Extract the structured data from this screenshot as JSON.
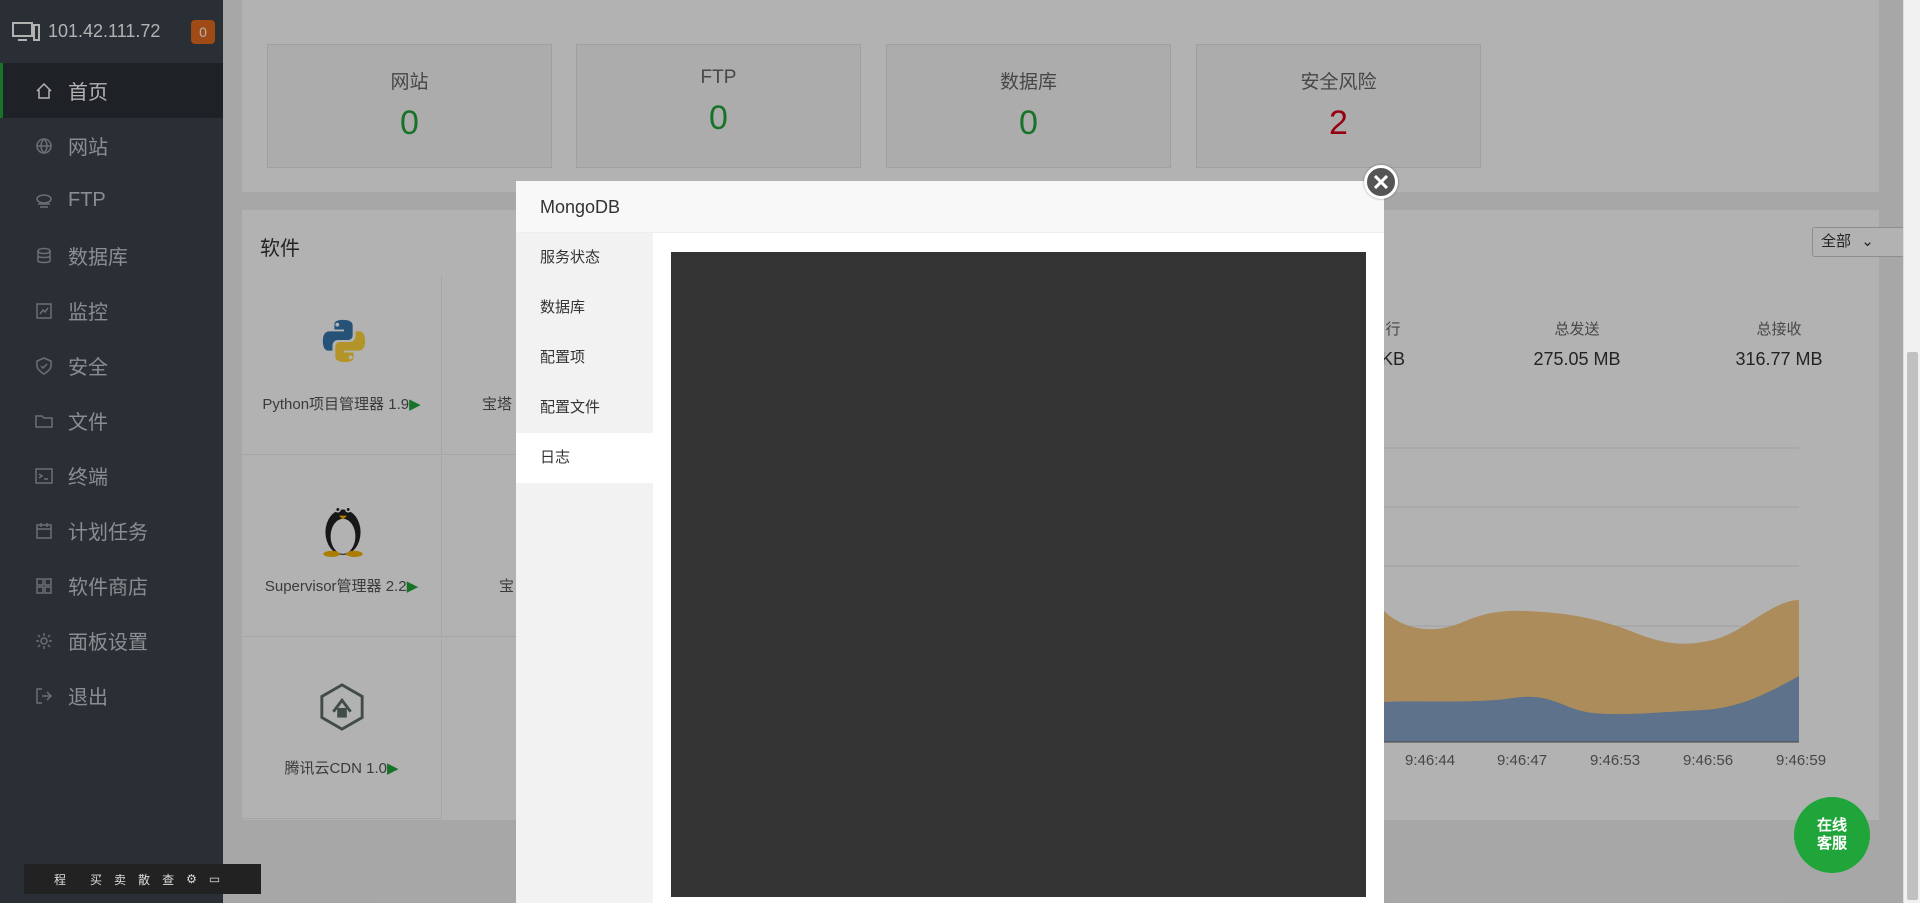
{
  "sidebar": {
    "ip": "101.42.111.72",
    "badge": "0",
    "items": [
      {
        "label": "首页",
        "icon": "home-icon"
      },
      {
        "label": "网站",
        "icon": "globe-icon"
      },
      {
        "label": "FTP",
        "icon": "ftp-icon"
      },
      {
        "label": "数据库",
        "icon": "database-icon"
      },
      {
        "label": "监控",
        "icon": "monitor-icon"
      },
      {
        "label": "安全",
        "icon": "shield-icon"
      },
      {
        "label": "文件",
        "icon": "folder-icon"
      },
      {
        "label": "终端",
        "icon": "terminal-icon"
      },
      {
        "label": "计划任务",
        "icon": "calendar-icon"
      },
      {
        "label": "软件商店",
        "icon": "grid-icon"
      },
      {
        "label": "面板设置",
        "icon": "gear-icon"
      },
      {
        "label": "退出",
        "icon": "logout-icon"
      }
    ]
  },
  "stats": [
    {
      "label": "网站",
      "value": "0"
    },
    {
      "label": "FTP",
      "value": "0"
    },
    {
      "label": "数据库",
      "value": "0"
    },
    {
      "label": "安全风险",
      "value": "2"
    }
  ],
  "software": {
    "title": "软件",
    "filter": "全部",
    "items": [
      {
        "name": "Python项目管理器 1.9"
      },
      {
        "name": "宝塔"
      },
      {
        "name": "Supervisor管理器 2.2"
      },
      {
        "name": "宝"
      },
      {
        "name": "腾讯云CDN 1.0"
      }
    ]
  },
  "network": {
    "partial_label": "行",
    "partial_value": "KB",
    "sent_label": "总发送",
    "sent_value": "275.05 MB",
    "recv_label": "总接收",
    "recv_value": "316.77 MB",
    "xticks": [
      "9:46:44",
      "9:46:47",
      "9:46:53",
      "9:46:56",
      "9:46:59"
    ]
  },
  "modal": {
    "title": "MongoDB",
    "tabs": [
      "服务状态",
      "数据库",
      "配置项",
      "配置文件",
      "日志"
    ],
    "active_tab": 4
  },
  "chat": {
    "line1": "在线",
    "line2": "客服"
  },
  "toolbar": [
    "程",
    "买",
    "卖",
    "散",
    "查"
  ],
  "colors": {
    "accent": "#20a53a",
    "danger": "#d9001b",
    "sidebar": "#3c444d"
  }
}
